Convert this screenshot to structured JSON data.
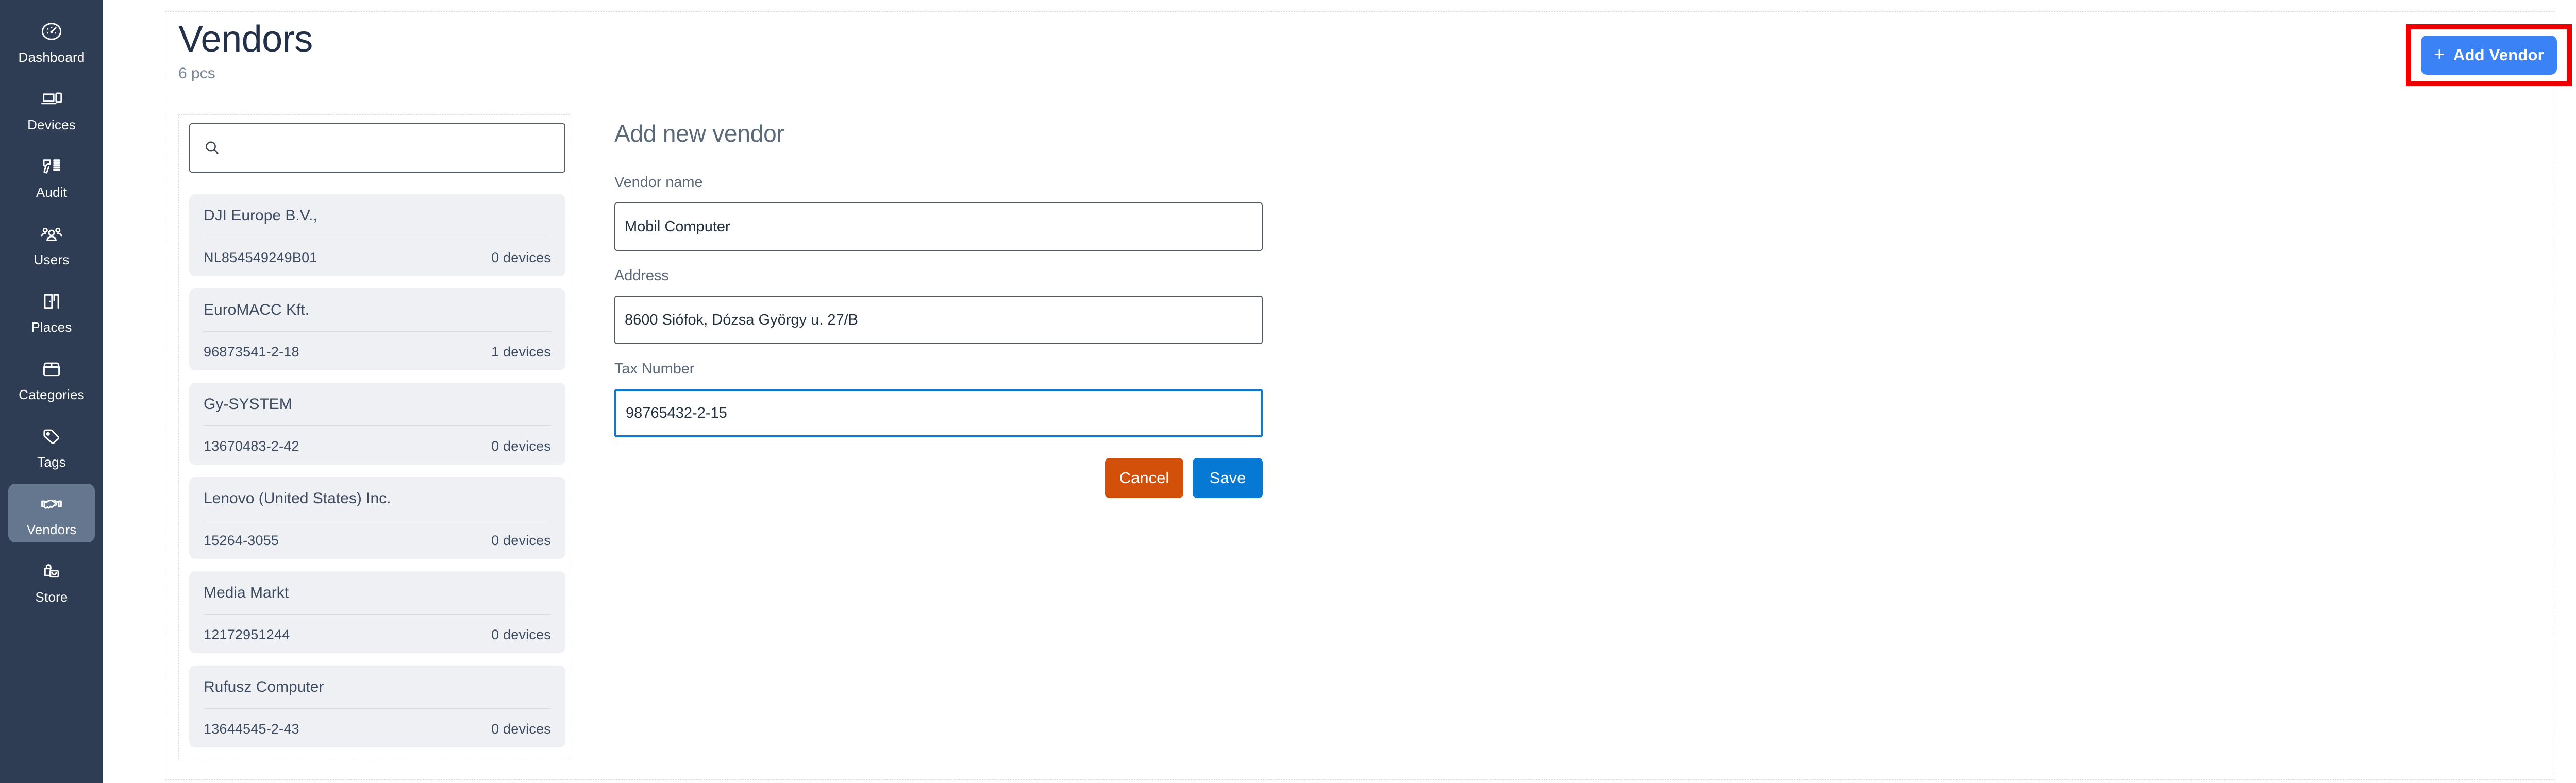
{
  "sidebar": {
    "items": [
      {
        "label": "Dashboard",
        "icon": "dashboard-gauge-icon",
        "active": false
      },
      {
        "label": "Devices",
        "icon": "devices-laptop-phone-icon",
        "active": false
      },
      {
        "label": "Audit",
        "icon": "audit-barcode-scanner-icon",
        "active": false
      },
      {
        "label": "Users",
        "icon": "users-group-icon",
        "active": false
      },
      {
        "label": "Places",
        "icon": "places-door-icon",
        "active": false
      },
      {
        "label": "Categories",
        "icon": "categories-box-icon",
        "active": false
      },
      {
        "label": "Tags",
        "icon": "tags-tag-icon",
        "active": false
      },
      {
        "label": "Vendors",
        "icon": "vendors-handshake-icon",
        "active": true
      },
      {
        "label": "Store",
        "icon": "store-bag-icon",
        "active": false
      }
    ]
  },
  "header": {
    "title": "Vendors",
    "count": "6 pcs",
    "add_button_label": "Add Vendor",
    "add_button_plus": "+",
    "add_button_color": "#3b82f6",
    "highlight_color": "#ee0000"
  },
  "search": {
    "value": "",
    "placeholder": "",
    "icon": "search-icon"
  },
  "vendors": [
    {
      "name": "DJI Europe B.V.,",
      "tax": "NL854549249B01",
      "devices": "0 devices"
    },
    {
      "name": "EuroMACC Kft.",
      "tax": "96873541-2-18",
      "devices": "1 devices"
    },
    {
      "name": "Gy-SYSTEM",
      "tax": "13670483-2-42",
      "devices": "0 devices"
    },
    {
      "name": "Lenovo (United States) Inc.",
      "tax": "15264-3055",
      "devices": "0 devices"
    },
    {
      "name": "Media Markt",
      "tax": "12172951244",
      "devices": "0 devices"
    },
    {
      "name": "Rufusz Computer",
      "tax": "13644545-2-43",
      "devices": "0 devices"
    }
  ],
  "form": {
    "title": "Add new vendor",
    "fields": {
      "vendor_name": {
        "label": "Vendor name",
        "value": "Mobil Computer",
        "placeholder": ""
      },
      "address": {
        "label": "Address",
        "value": "8600 Siófok, Dózsa György u. 27/B",
        "placeholder": ""
      },
      "tax_number": {
        "label": "Tax Number",
        "value": "98765432-2-15",
        "placeholder": "",
        "focused": true
      }
    },
    "cancel_label": "Cancel",
    "save_label": "Save",
    "cancel_color": "#d2500a",
    "save_color": "#0679d4"
  }
}
